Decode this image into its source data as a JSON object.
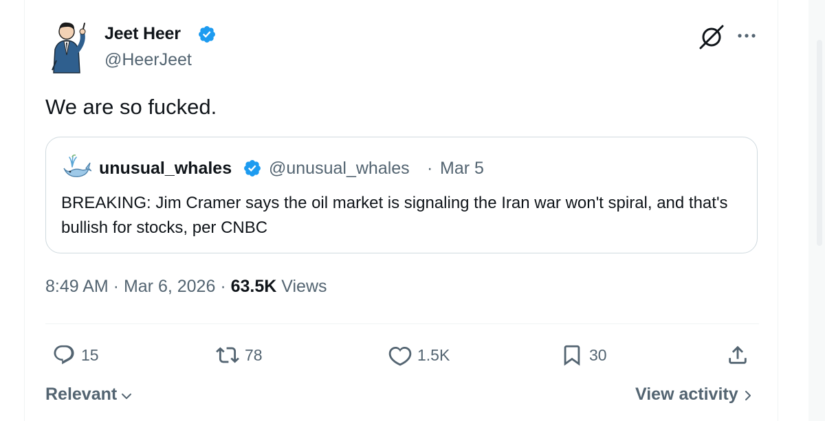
{
  "author": {
    "display_name": "Jeet Heer",
    "handle": "@HeerJeet",
    "avatar_icon": "avatar-caricature-icon",
    "verified_icon": "verified-badge-icon"
  },
  "header_icons": {
    "grok": "grok-icon",
    "more": "more-icon"
  },
  "tweet": {
    "text": "We are so fucked."
  },
  "quote": {
    "display_name": "unusual_whales",
    "handle": "@unusual_whales",
    "separator": "·",
    "date": "Mar 5",
    "text": "BREAKING: Jim Cramer says the oil market is signaling the Iran war won't spiral, and that's bullish for stocks, per CNBC"
  },
  "meta": {
    "time": "8:49 AM",
    "sep1": " · ",
    "date": "Mar 6, 2026",
    "sep2": " · ",
    "views_count": "63.5K",
    "views_label": " Views"
  },
  "actions": {
    "replies": "15",
    "reposts": "78",
    "likes": "1.5K",
    "bookmarks": "30"
  },
  "footer": {
    "sort_label": "Relevant",
    "view_activity_label": "View activity"
  },
  "colors": {
    "text": "#0f1419",
    "secondary": "#536471",
    "verified": "#1d9bf0",
    "border": "#cfd9de"
  }
}
